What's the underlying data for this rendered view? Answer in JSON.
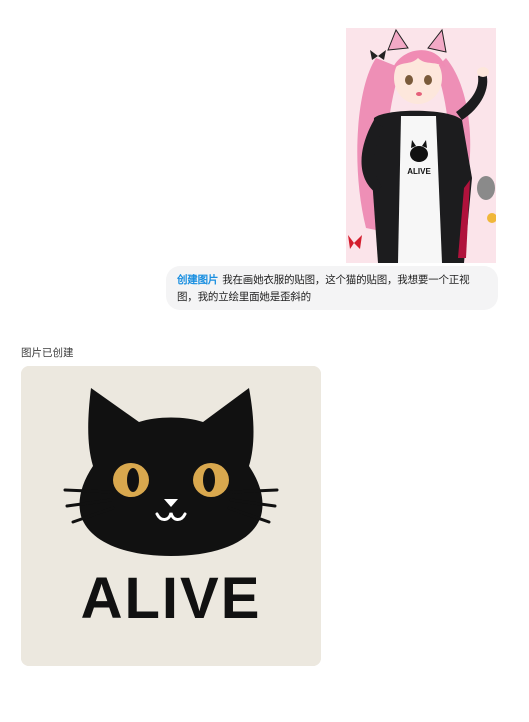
{
  "conversation": {
    "user_message": {
      "tag": "创建图片",
      "text": "我在画她衣服的贴图，这个猫的贴图，我想要一个正视图，我的立绘里面她是歪斜的"
    },
    "assistant_message": {
      "status": "图片已创建",
      "generated_text": "ALIVE"
    }
  },
  "colors": {
    "tag_blue": "#1a8fe0",
    "card_bg": "#ece8df",
    "cat_black": "#111111",
    "cat_eye": "#d9a84e"
  },
  "icons": [
    "anime-illustration",
    "black-cat-logo"
  ]
}
